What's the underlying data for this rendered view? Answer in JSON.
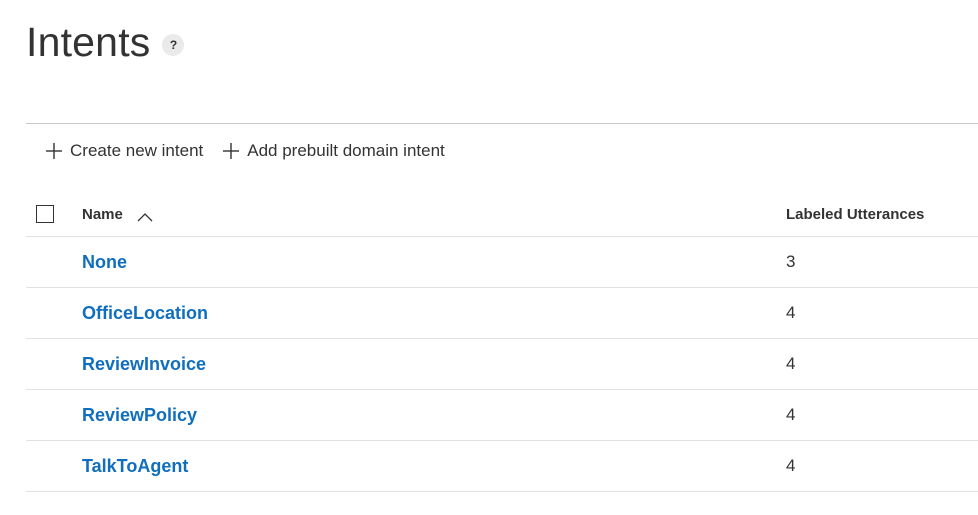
{
  "page": {
    "title": "Intents",
    "help_glyph": "?",
    "help_icon": "question-circle-icon"
  },
  "toolbar": {
    "create_label": "Create new intent",
    "add_prebuilt_label": "Add prebuilt domain intent",
    "plus_icon": "plus-icon"
  },
  "table": {
    "columns": {
      "name": "Name",
      "labeled_utterances": "Labeled Utterances"
    },
    "sort": {
      "column": "name",
      "direction": "ascending",
      "icon": "chevron-up-icon"
    },
    "rows": [
      {
        "name": "None",
        "labeled_utterances": "3"
      },
      {
        "name": "OfficeLocation",
        "labeled_utterances": "4"
      },
      {
        "name": "ReviewInvoice",
        "labeled_utterances": "4"
      },
      {
        "name": "ReviewPolicy",
        "labeled_utterances": "4"
      },
      {
        "name": "TalkToAgent",
        "labeled_utterances": "4"
      }
    ]
  },
  "colors": {
    "link": "#106ebe",
    "text": "#333333",
    "divider": "#c8c8c8",
    "row_border": "#e1e1e1"
  }
}
